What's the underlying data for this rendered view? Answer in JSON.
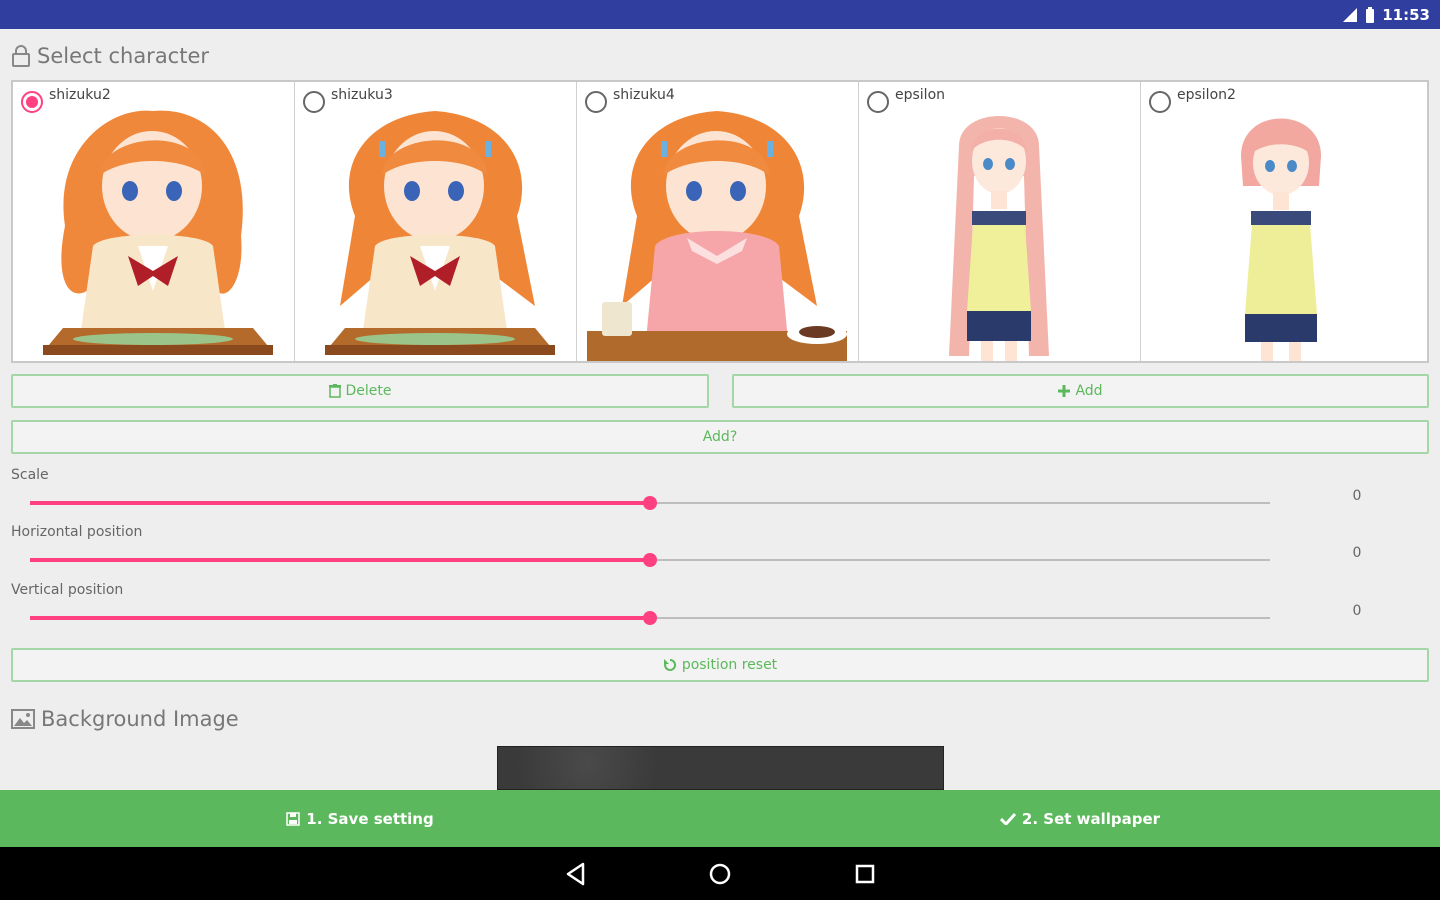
{
  "status_bar": {
    "time": "11:53"
  },
  "select_character": {
    "title": "Select character",
    "characters": [
      {
        "name": "shizuku2",
        "selected": true
      },
      {
        "name": "shizuku3",
        "selected": false
      },
      {
        "name": "shizuku4",
        "selected": false
      },
      {
        "name": "epsilon",
        "selected": false
      },
      {
        "name": "epsilon2",
        "selected": false
      }
    ]
  },
  "buttons": {
    "delete": "Delete",
    "add": "Add",
    "add_help": "Add?",
    "position_reset": "position reset"
  },
  "sliders": {
    "scale": {
      "label": "Scale",
      "value": "0",
      "fraction": 0.5
    },
    "horizontal": {
      "label": "Horizontal position",
      "value": "0",
      "fraction": 0.5
    },
    "vertical": {
      "label": "Vertical position",
      "value": "0",
      "fraction": 0.5
    }
  },
  "background": {
    "title": "Background Image"
  },
  "bottom_bar": {
    "save": "1. Save setting",
    "set_wallpaper": "2. Set wallpaper"
  },
  "colors": {
    "status_bar": "#303f9f",
    "accent": "#ff4081",
    "primary_green": "#5cb85c"
  }
}
